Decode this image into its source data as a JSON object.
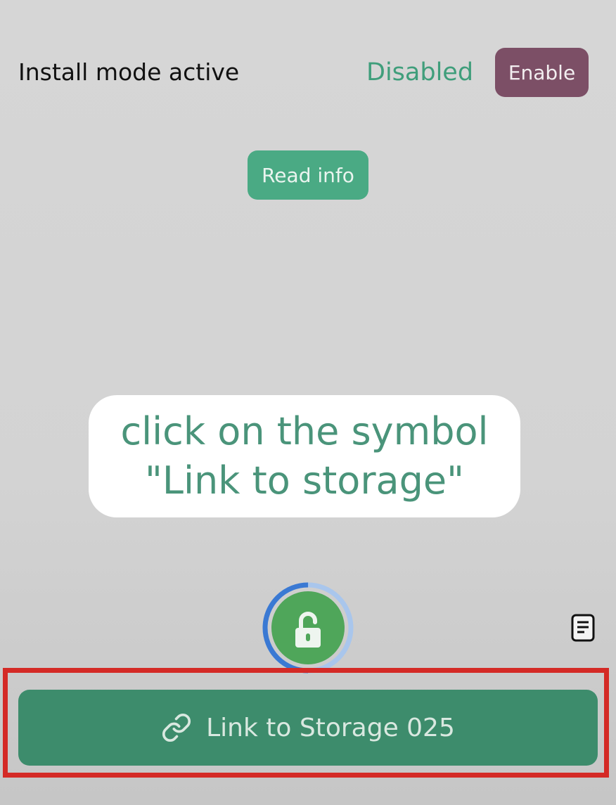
{
  "install_mode": {
    "label": "Install mode active",
    "status": "Disabled",
    "enable_label": "Enable"
  },
  "read_info_label": "Read info",
  "instruction": {
    "line1": "click on the symbol",
    "line2": "\"Link to storage\""
  },
  "lock_button": {
    "icon": "unlocked-padlock-icon",
    "progress": 0.5
  },
  "document_icon": "document-icon",
  "link_storage": {
    "icon": "link-icon",
    "label": "Link to Storage 025"
  },
  "colors": {
    "accent_green": "#3f9e7b",
    "enable_button": "#7c4f66",
    "highlight_red": "#d42a26",
    "progress_blue": "#3a79d3"
  }
}
